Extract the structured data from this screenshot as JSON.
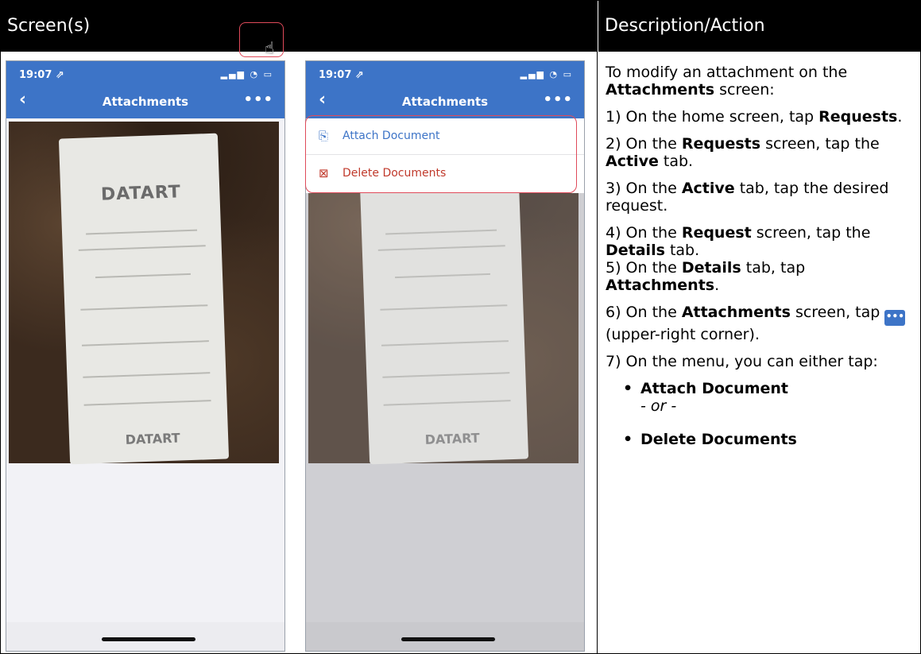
{
  "header": {
    "screens": "Screen(s)",
    "description": "Description/Action"
  },
  "phone1": {
    "time": "19:07 ⇗",
    "status_icons": "▂▄▆ ◔ ▭",
    "title": "Attachments",
    "back_icon": "chevron-left-icon",
    "more_label": "•••",
    "receipt_logo": "DATART"
  },
  "phone2": {
    "time": "19:07 ⇗",
    "status_icons": "▂▄▆ ◔ ▭",
    "title": "Attachments",
    "more_label": "•••",
    "receipt_logo": "DATART",
    "menu": [
      {
        "label": "Attach Document",
        "icon": "attach-document-icon",
        "color": "#3d74c7"
      },
      {
        "label": "Delete Documents",
        "icon": "delete-documents-icon",
        "color": "#c0392b"
      }
    ]
  },
  "desc": {
    "intro_pre": "To modify an attachment on the ",
    "intro_bold": "Attachments",
    "intro_post": " screen:",
    "s1_pre": "1) On the home screen, tap ",
    "s1_bold": "Requests",
    "s1_post": ".",
    "s2_pre": "2) On the ",
    "s2_bold1": "Requests",
    "s2_mid": " screen, tap the ",
    "s2_bold2": "Active",
    "s2_post": " tab.",
    "s3_pre": "3) On the ",
    "s3_bold": "Active",
    "s3_post": " tab, tap the desired request.",
    "s4_pre": "4) On the ",
    "s4_bold1": "Request",
    "s4_mid": " screen, tap the ",
    "s4_bold2": "Details",
    "s4_post": " tab.",
    "s5_pre": "5) On the ",
    "s5_bold1": "Details",
    "s5_mid": " tab, tap ",
    "s5_bold2": "Attachments",
    "s5_post": ".",
    "s6_pre": "6) On the ",
    "s6_bold": "Attachments",
    "s6_mid": " screen, tap ",
    "s6_icon": "•••",
    "s6_post": " (upper-right corner).",
    "s7": "7) On the menu, you can either tap:",
    "bullet1": "Attach Document",
    "or": "- or -",
    "bullet2": "Delete Documents"
  },
  "colors": {
    "brand": "#3d74c7",
    "highlight": "#e04a5a",
    "delete": "#c0392b"
  }
}
